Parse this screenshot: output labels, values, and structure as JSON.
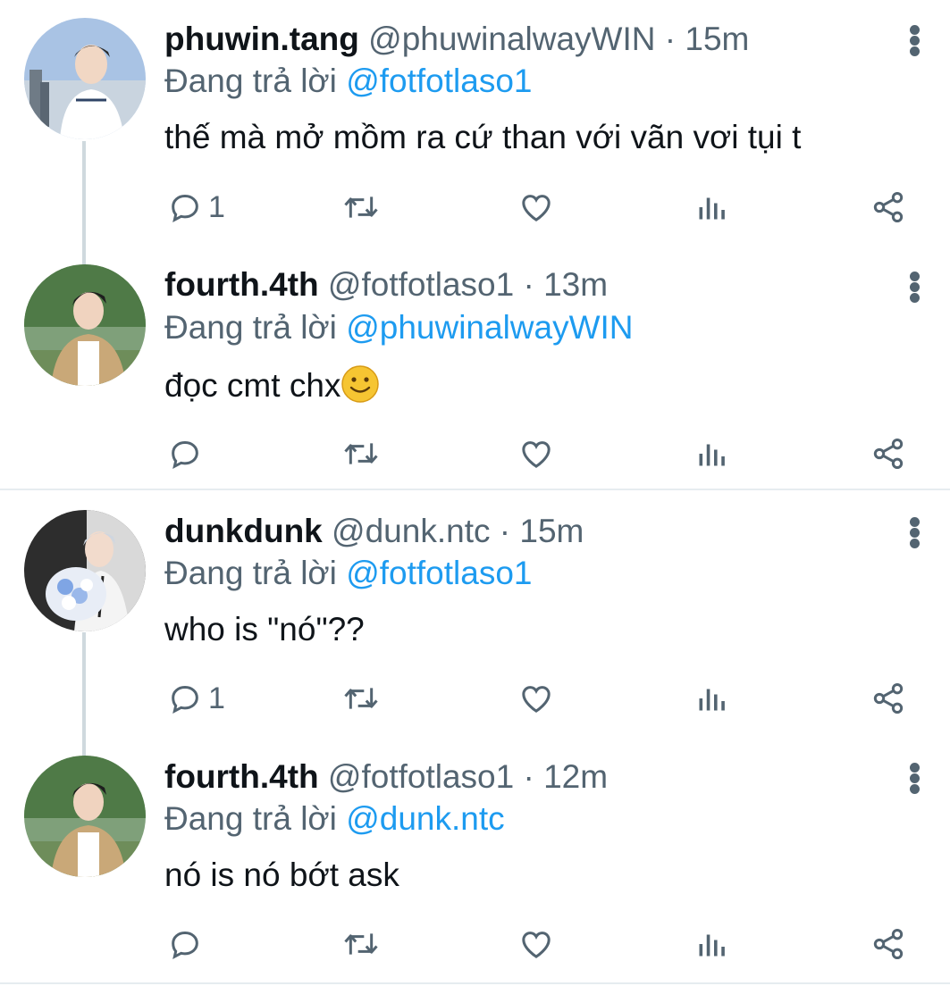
{
  "tweets": [
    {
      "display_name": "phuwin.tang",
      "handle": "@phuwinalwayWIN",
      "time": "· 15m",
      "reply_prefix": "Đang trả lời",
      "reply_to": "@fotfotlaso1",
      "text": "thế mà mở mồm ra cứ than với vãn vơi tụi t",
      "reply_count": "1"
    },
    {
      "display_name": "fourth.4th",
      "handle": "@fotfotlaso1",
      "time": "· 13m",
      "reply_prefix": "Đang trả lời",
      "reply_to": "@phuwinalwayWIN",
      "text": "đọc cmt chx",
      "reply_count": ""
    },
    {
      "display_name": "dunkdunk",
      "handle": "@dunk.ntc",
      "time": "· 15m",
      "reply_prefix": "Đang trả lời",
      "reply_to": "@fotfotlaso1",
      "text": "who is \"nó\"??",
      "reply_count": "1"
    },
    {
      "display_name": "fourth.4th",
      "handle": "@fotfotlaso1",
      "time": "· 12m",
      "reply_prefix": "Đang trả lời",
      "reply_to": "@dunk.ntc",
      "text": "nó is nó bớt ask",
      "reply_count": ""
    }
  ],
  "icons": {
    "reply": "reply-icon",
    "retweet": "retweet-icon",
    "like": "like-icon",
    "analytics": "analytics-icon",
    "share": "share-icon",
    "more": "more-vertical-icon",
    "emoji": "slightly-smiling-face-emoji"
  },
  "colors": {
    "mention": "#1d9bf0",
    "secondary_text": "#536471",
    "primary_text": "#0f1419",
    "thread_line": "#cfd9de"
  }
}
